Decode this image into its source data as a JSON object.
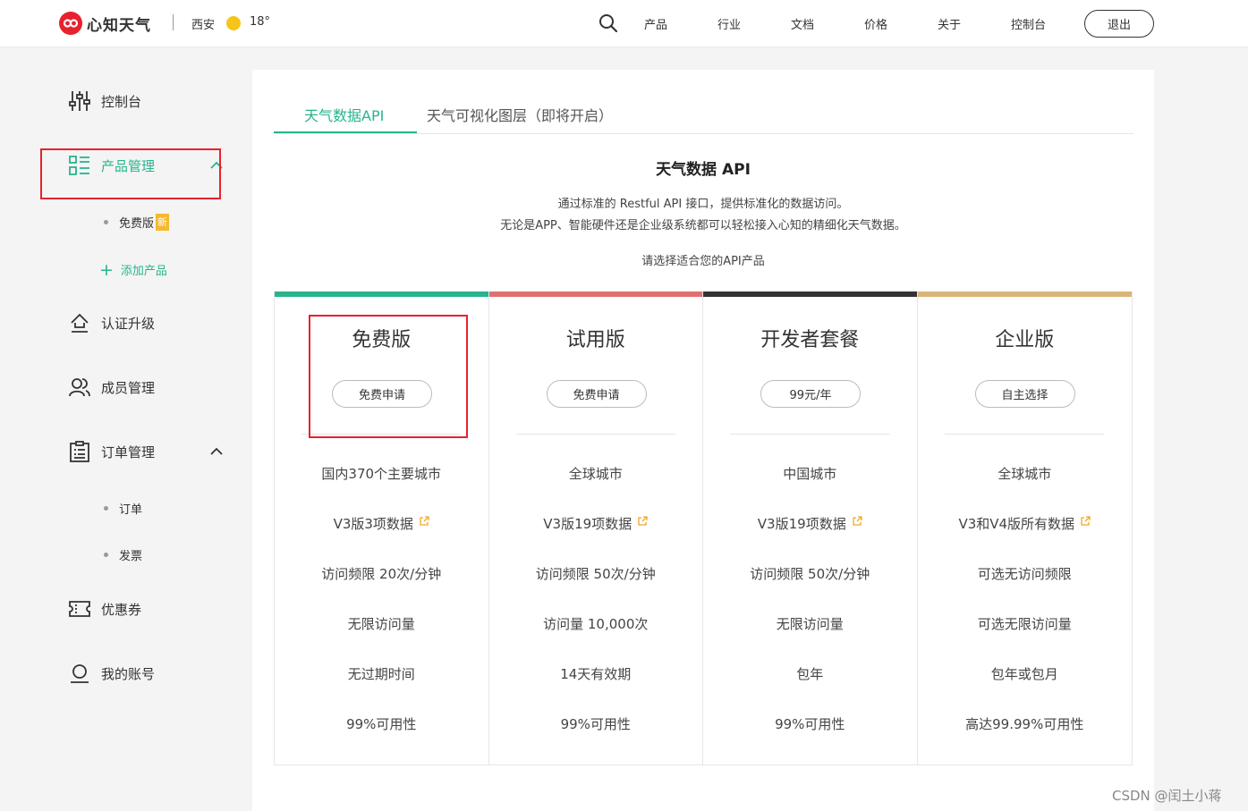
{
  "header": {
    "brand": "心知天气",
    "city": "西安",
    "temperature": "18°",
    "nav": [
      "产品",
      "行业",
      "文档",
      "价格",
      "关于",
      "控制台"
    ],
    "logout_label": "退出"
  },
  "sidebar": {
    "items": [
      {
        "label": "控制台",
        "icon": "sliders-icon"
      },
      {
        "label": "产品管理",
        "icon": "grid-list-icon"
      },
      {
        "label": "认证升级",
        "icon": "upgrade-icon"
      },
      {
        "label": "成员管理",
        "icon": "users-icon"
      },
      {
        "label": "订单管理",
        "icon": "clipboard-icon"
      },
      {
        "label": "优惠券",
        "icon": "coupon-icon"
      },
      {
        "label": "我的账号",
        "icon": "user-icon"
      }
    ],
    "product_sub": {
      "free_label": "免费版",
      "new_badge": "新",
      "add_label": "添加产品"
    },
    "order_sub": [
      "订单",
      "发票"
    ],
    "accent": "#27b48e"
  },
  "main": {
    "tabs": [
      "天气数据API",
      "天气可视化图层（即将开启）"
    ],
    "title": "天气数据 API",
    "desc_line1": "通过标准的 Restful API 接口，提供标准化的数据访问。",
    "desc_line2": "无论是APP、智能硬件还是企业级系统都可以轻松接入心知的精细化天气数据。",
    "prompt": "请选择适合您的API产品",
    "plans": [
      {
        "name": "免费版",
        "button": "免费申请",
        "color": "#27b48e",
        "features": [
          "国内370个主要城市",
          "V3版3项数据",
          "访问频限 20次/分钟",
          "无限访问量",
          "无过期时间",
          "99%可用性"
        ]
      },
      {
        "name": "试用版",
        "button": "免费申请",
        "color": "#e07070",
        "features": [
          "全球城市",
          "V3版19项数据",
          "访问频限 50次/分钟",
          "访问量 10,000次",
          "14天有效期",
          "99%可用性"
        ]
      },
      {
        "name": "开发者套餐",
        "button": "99元/年",
        "color": "#333333",
        "features": [
          "中国城市",
          "V3版19项数据",
          "访问频限 50次/分钟",
          "无限访问量",
          "包年",
          "99%可用性"
        ]
      },
      {
        "name": "企业版",
        "button": "自主选择",
        "color": "#d9b57a",
        "features": [
          "全球城市",
          "V3和V4版所有数据",
          "可选无访问频限",
          "可选无限访问量",
          "包年或包月",
          "高达99.99%可用性"
        ]
      }
    ]
  },
  "watermark": "CSDN @闰土小蒋"
}
